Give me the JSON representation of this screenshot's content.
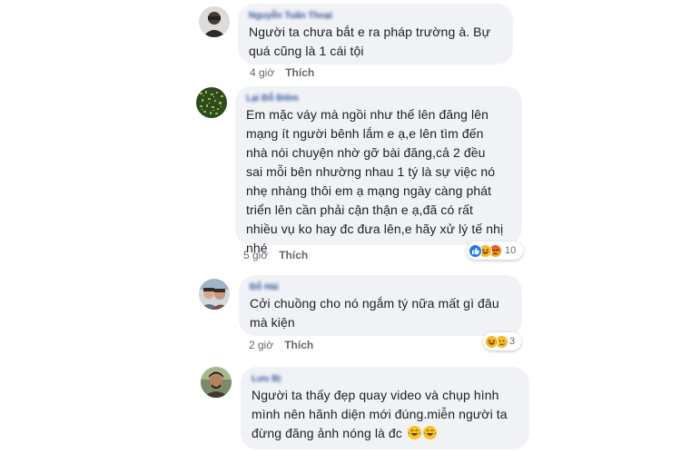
{
  "comments": [
    {
      "author": "Nguyễn Tuấn Thoại",
      "lines": [
        "Người ta chưa bắt e ra pháp trường à. Bự",
        "quá cũng là 1 cái tội"
      ],
      "time": "4 giờ",
      "like_label": "Thích"
    },
    {
      "author": "Lại Đỗ Điêm",
      "lines": [
        "Em mặc váy mà ngồi như thế lên đăng lên",
        "mạng ít người bênh lắm e ạ,e lên tìm đến",
        "nhà nói chuyện nhờ gỡ bài đăng,cả 2 đều",
        "sai mỗi bên nhường nhau 1 tý là sự việc nó",
        "nhẹ nhàng thôi em ạ mạng ngày càng phát",
        "triển lên cần phải cận thận e ạ,đã có rất",
        "nhiều vụ ko hay đc đưa lên,e hãy xử lý tế nhị",
        "nhé"
      ],
      "time": "5 giờ",
      "like_label": "Thích",
      "reactions": {
        "icons": [
          "like-icon",
          "haha-icon",
          "angry-icon"
        ],
        "count": "10"
      }
    },
    {
      "author": "Đỗ Hải",
      "lines": [
        "Cởi chuồng cho nó ngắm tý nữa mất gì đâu",
        "mà kiện"
      ],
      "time": "2 giờ",
      "like_label": "Thích",
      "reactions": {
        "icons": [
          "haha-icon",
          "sad-icon"
        ],
        "count": "3"
      }
    },
    {
      "author": "Lưu Bị",
      "lines": [
        "Người ta thấy đẹp quay video và chụp hình",
        "mình nên hãnh diện mới đúng.miễn người ta",
        "đừng đăng ảnh nóng là đc"
      ],
      "trailing_emoji": [
        "tears-of-joy-emoji",
        "tears-of-joy-emoji"
      ]
    }
  ],
  "colors": {
    "bubble": "#f0f2f5",
    "author": "#385898",
    "text": "#1c1e21",
    "meta": "#65676b"
  }
}
